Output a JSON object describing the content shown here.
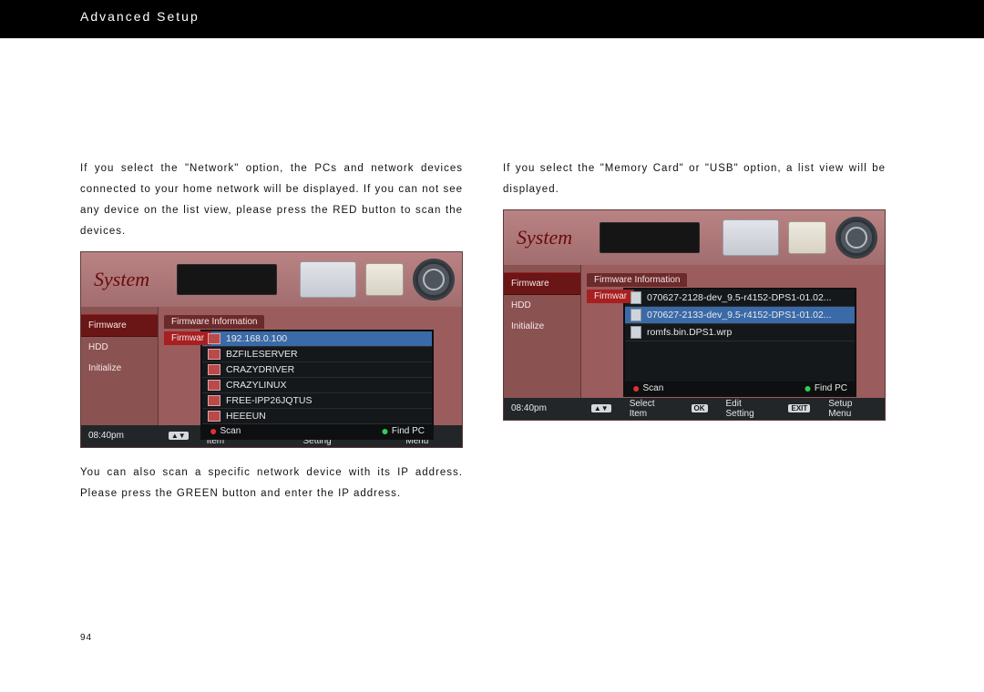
{
  "header": {
    "title": "Advanced Setup"
  },
  "page_number": "94",
  "left": {
    "para1": "If you select the \"Network\" option, the PCs and network devices connected to your home network will be displayed. If you can not see any device on the list view, please press the RED button to scan the devices.",
    "para2": "You can also scan a specific network device with its IP address. Please press the GREEN button and enter the IP address."
  },
  "right": {
    "para1": "If you select the \"Memory Card\" or \"USB\" option, a list view will be displayed."
  },
  "shot_common": {
    "brand": "System",
    "side_firmware": "Firmware",
    "side_hdd": "HDD",
    "side_initialize": "Initialize",
    "hdr_fwinfo": "Firmware Information",
    "hdr_fw": "Firmwar",
    "time": "08:40pm",
    "scan": "Scan",
    "find_pc": "Find PC",
    "footer_select": "Select Item",
    "footer_edit": "Edit Setting",
    "footer_menu": "Setup Menu",
    "kbd_arrows": "▲▼",
    "kbd_ok": "OK",
    "kbd_exit": "EXIT"
  },
  "shot1": {
    "rows": [
      "192.168.0.100",
      "BZFILESERVER",
      "CRAZYDRIVER",
      "CRAZYLINUX",
      "FREE-IPP26JQTUS",
      "HEEEUN"
    ]
  },
  "shot2": {
    "rows": [
      "070627-2128-dev_9.5-r4152-DPS1-01.02...",
      "070627-2133-dev_9.5-r4152-DPS1-01.02...",
      "romfs.bin.DPS1.wrp"
    ]
  }
}
